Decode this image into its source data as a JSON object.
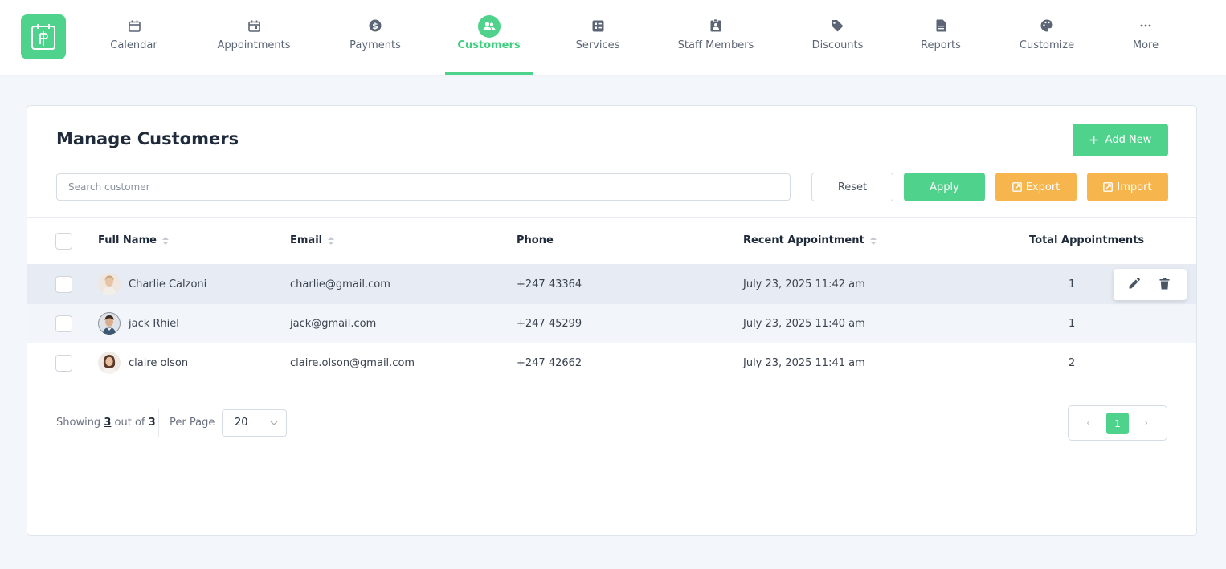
{
  "nav": {
    "items": [
      {
        "label": "Calendar",
        "icon": "calendar-icon"
      },
      {
        "label": "Appointments",
        "icon": "appointment-icon"
      },
      {
        "label": "Payments",
        "icon": "dollar-icon"
      },
      {
        "label": "Customers",
        "icon": "customers-icon",
        "active": true
      },
      {
        "label": "Services",
        "icon": "services-icon"
      },
      {
        "label": "Staff Members",
        "icon": "staff-icon"
      },
      {
        "label": "Discounts",
        "icon": "tag-icon"
      },
      {
        "label": "Reports",
        "icon": "report-icon"
      },
      {
        "label": "Customize",
        "icon": "palette-icon"
      },
      {
        "label": "More",
        "icon": "more-icon"
      }
    ]
  },
  "colors": {
    "accent": "#4fd28b",
    "warning": "#f6b54d"
  },
  "page": {
    "title": "Manage Customers",
    "add_new_label": "Add New",
    "search_placeholder": "Search customer",
    "reset_label": "Reset",
    "apply_label": "Apply",
    "export_label": "Export",
    "import_label": "Import"
  },
  "table": {
    "headers": {
      "full_name": "Full Name",
      "email": "Email",
      "phone": "Phone",
      "recent": "Recent Appointment",
      "total": "Total Appointments"
    },
    "rows": [
      {
        "name": "Charlie Calzoni",
        "email": "charlie@gmail.com",
        "phone": "+247 43364",
        "recent": "July 23, 2025 11:42 am",
        "total": "1"
      },
      {
        "name": "jack Rhiel",
        "email": "jack@gmail.com",
        "phone": "+247 45299",
        "recent": "July 23, 2025 11:40 am",
        "total": "1"
      },
      {
        "name": "claire olson",
        "email": "claire.olson@gmail.com",
        "phone": "+247 42662",
        "recent": "July 23, 2025 11:41 am",
        "total": "2"
      }
    ]
  },
  "footer": {
    "showing_prefix": "Showing",
    "showing_count": "3",
    "out_of": "out of",
    "total": "3",
    "per_page_label": "Per Page",
    "per_page_value": "20",
    "pager_prev": "‹",
    "pager_current": "1",
    "pager_next": "›"
  }
}
